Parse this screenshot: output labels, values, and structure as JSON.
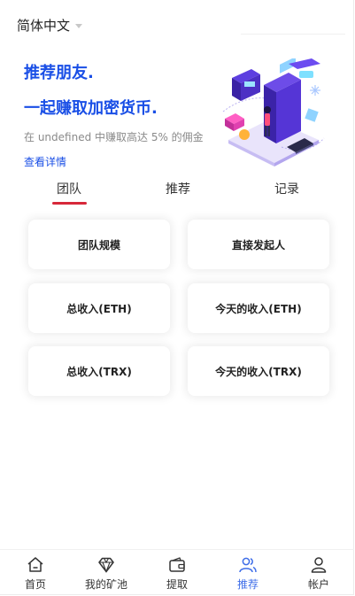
{
  "header": {
    "language": "简体中文"
  },
  "hero": {
    "title_line1": "推荐朋友.",
    "title_line2": "一起赚取加密货币.",
    "subtitle": "在 undefined 中赚取高达 5% 的佣金",
    "details_link": "查看详情"
  },
  "tabs": [
    {
      "label": "团队",
      "active": true
    },
    {
      "label": "推荐",
      "active": false
    },
    {
      "label": "记录",
      "active": false
    }
  ],
  "stats_cards": [
    {
      "label": "团队规模"
    },
    {
      "label": "直接发起人"
    },
    {
      "label": "总收入(ETH)"
    },
    {
      "label": "今天的收入(ETH)"
    },
    {
      "label": "总收入(TRX)"
    },
    {
      "label": "今天的收入(TRX)"
    }
  ],
  "bottom_nav": [
    {
      "label": "首页",
      "icon": "home-icon",
      "active": false
    },
    {
      "label": "我的矿池",
      "icon": "diamond-icon",
      "active": false
    },
    {
      "label": "提取",
      "icon": "wallet-icon",
      "active": false
    },
    {
      "label": "推荐",
      "icon": "users-icon",
      "active": true
    },
    {
      "label": "帐户",
      "icon": "user-icon",
      "active": false
    }
  ],
  "colors": {
    "accent": "#1a4fe6",
    "tab_underline": "#d7283a",
    "nav_active": "#3f6ee8",
    "muted_text": "#8a8a8a"
  }
}
